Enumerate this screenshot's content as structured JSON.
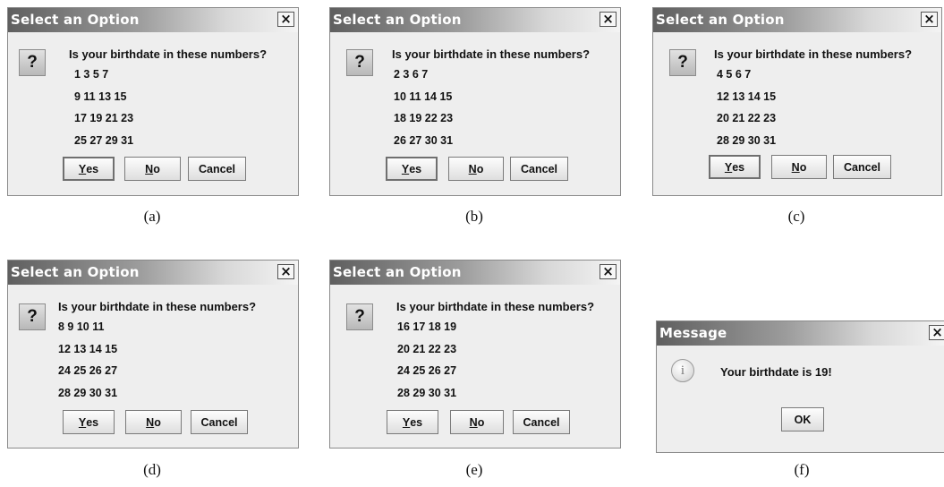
{
  "question_dialogs": [
    {
      "caption": "(a)",
      "title": "Select an Option",
      "close": "×",
      "icon": "question-icon",
      "question": "Is your birthdate in these numbers?",
      "rows": [
        "1 3 5 7",
        "9 11 13 15",
        "17 19 21 23",
        "25 27 29 31"
      ],
      "buttons": {
        "yes_first": "Y",
        "yes_rest": "es",
        "no_first": "N",
        "no_rest": "o",
        "cancel": "Cancel"
      }
    },
    {
      "caption": "(b)",
      "title": "Select an Option",
      "close": "×",
      "icon": "question-icon",
      "question": "Is your birthdate in these numbers?",
      "rows": [
        "2 3 6 7",
        "10 11 14 15",
        "18 19 22 23",
        "26 27 30 31"
      ],
      "buttons": {
        "yes_first": "Y",
        "yes_rest": "es",
        "no_first": "N",
        "no_rest": "o",
        "cancel": "Cancel"
      }
    },
    {
      "caption": "(c)",
      "title": "Select an Option",
      "close": "×",
      "icon": "question-icon",
      "question": "Is your birthdate in these numbers?",
      "rows": [
        "4 5 6 7",
        "12 13 14 15",
        "20 21 22 23",
        "28 29 30 31"
      ],
      "buttons": {
        "yes_first": "Y",
        "yes_rest": "es",
        "no_first": "N",
        "no_rest": "o",
        "cancel": "Cancel"
      }
    },
    {
      "caption": "(d)",
      "title": "Select an Option",
      "close": "×",
      "icon": "question-icon",
      "question": "Is your birthdate in these numbers?",
      "rows": [
        "8 9 10 11",
        "12 13 14 15",
        "24 25 26 27",
        "28 29 30 31"
      ],
      "buttons": {
        "yes_first": "Y",
        "yes_rest": "es",
        "no_first": "N",
        "no_rest": "o",
        "cancel": "Cancel"
      }
    },
    {
      "caption": "(e)",
      "title": "Select an Option",
      "close": "×",
      "icon": "question-icon",
      "question": "Is your birthdate in these numbers?",
      "rows": [
        "16 17 18 19",
        "20 21 22 23",
        "24 25 26 27",
        "28 29 30 31"
      ],
      "buttons": {
        "yes_first": "Y",
        "yes_rest": "es",
        "no_first": "N",
        "no_rest": "o",
        "cancel": "Cancel"
      }
    }
  ],
  "message_dialog": {
    "caption": "(f)",
    "title": "Message",
    "close": "×",
    "icon": "info-icon",
    "icon_glyph": "i",
    "message": "Your birthdate is 19!",
    "ok": "OK"
  },
  "question_glyph": "?"
}
